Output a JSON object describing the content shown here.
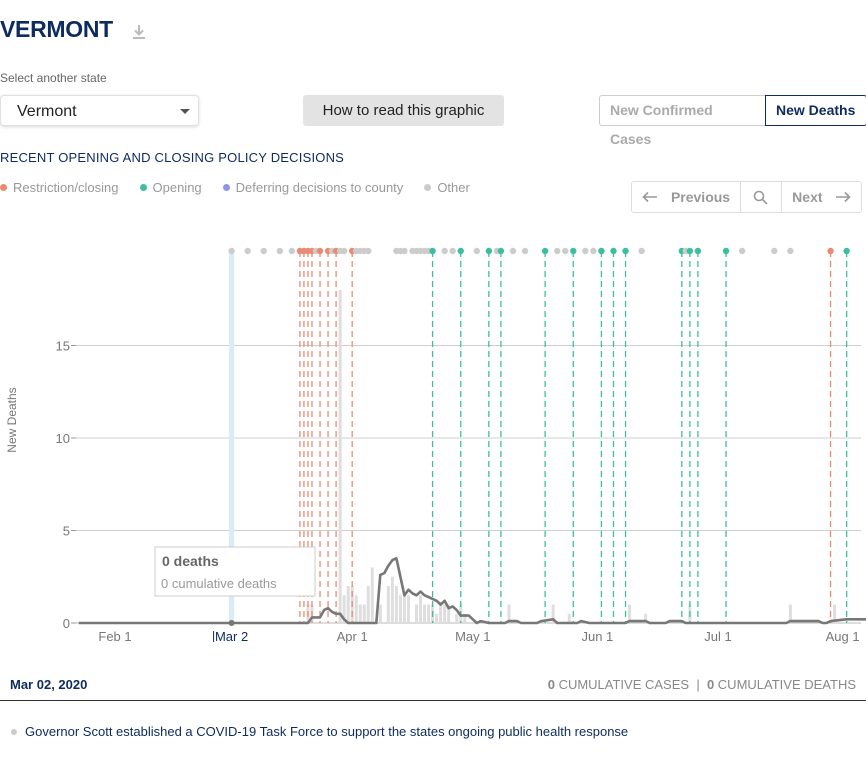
{
  "header": {
    "title": "VERMONT",
    "download_icon": "download-icon"
  },
  "state_select": {
    "label": "Select another state",
    "value": "Vermont"
  },
  "how_button": "How to read this graphic",
  "metric_toggle": {
    "options": [
      "New Confirmed Cases",
      "New Deaths"
    ],
    "selected": "New Deaths"
  },
  "policy": {
    "title": "RECENT OPENING AND CLOSING POLICY DECISIONS",
    "legend": [
      {
        "label": "Restriction/closing",
        "color": "#ea8a73"
      },
      {
        "label": "Opening",
        "color": "#3cbfa0"
      },
      {
        "label": "Deferring decisions to county",
        "color": "#8f92ee"
      },
      {
        "label": "Other",
        "color": "#cccccc"
      }
    ]
  },
  "pager": {
    "previous": "Previous",
    "next": "Next",
    "search_icon": "search-icon"
  },
  "tooltip": {
    "value": "0 deaths",
    "cumulative": "0 cumulative deaths"
  },
  "chart_data": {
    "type": "line",
    "ylabel": "New Deaths",
    "ylim": [
      0,
      19
    ],
    "yticks": [
      0,
      5,
      10,
      15
    ],
    "grid": true,
    "xtick_labels": [
      "Feb 1",
      "Mar 2",
      "Apr 1",
      "May 1",
      "Jun 1",
      "Jul 1",
      "Aug 1"
    ],
    "xtick_day": [
      31,
      60,
      90,
      120,
      151,
      181,
      212
    ],
    "selected_day": 60,
    "x_range_days": [
      22,
      220
    ],
    "bars_daily": [
      [
        79,
        1
      ],
      [
        80,
        1
      ],
      [
        87,
        18
      ],
      [
        88,
        1.5
      ],
      [
        89,
        2
      ],
      [
        90,
        2
      ],
      [
        91,
        1.5
      ],
      [
        92,
        1
      ],
      [
        93,
        1
      ],
      [
        94,
        2
      ],
      [
        95,
        3
      ],
      [
        97,
        1
      ],
      [
        99,
        2
      ],
      [
        100,
        2.5
      ],
      [
        101,
        2
      ],
      [
        102,
        1.5
      ],
      [
        103,
        1.5
      ],
      [
        104,
        1.5
      ],
      [
        106,
        1
      ],
      [
        107,
        1.5
      ],
      [
        108,
        1
      ],
      [
        109,
        1
      ],
      [
        110,
        1
      ],
      [
        111,
        0.5
      ],
      [
        112,
        1
      ],
      [
        113,
        1
      ],
      [
        114,
        1
      ],
      [
        116,
        0.5
      ],
      [
        117,
        1
      ],
      [
        118,
        0.5
      ],
      [
        129,
        1
      ],
      [
        140,
        1
      ],
      [
        144,
        0.5
      ],
      [
        159,
        1
      ],
      [
        163,
        0.5
      ],
      [
        174,
        1
      ],
      [
        199,
        1
      ],
      [
        210,
        1
      ],
      [
        219,
        1
      ]
    ],
    "series": [
      {
        "name": "7-day average",
        "points": [
          [
            22,
            0
          ],
          [
            79,
            0
          ],
          [
            80,
            0.3
          ],
          [
            82,
            0.3
          ],
          [
            83,
            0.7
          ],
          [
            84,
            0.8
          ],
          [
            85,
            0.6
          ],
          [
            86,
            0.5
          ],
          [
            87,
            0.5
          ],
          [
            88,
            0.2
          ],
          [
            89,
            0
          ],
          [
            96,
            0
          ],
          [
            97,
            2.6
          ],
          [
            98,
            2.7
          ],
          [
            99,
            3.1
          ],
          [
            100,
            3.4
          ],
          [
            101,
            3.5
          ],
          [
            102,
            2.5
          ],
          [
            103,
            1.5
          ],
          [
            104,
            1.8
          ],
          [
            105,
            1.6
          ],
          [
            106,
            1.5
          ],
          [
            107,
            1.7
          ],
          [
            108,
            1.5
          ],
          [
            109,
            1.4
          ],
          [
            110,
            1.3
          ],
          [
            111,
            1.2
          ],
          [
            112,
            1
          ],
          [
            113,
            1.2
          ],
          [
            114,
            0.8
          ],
          [
            115,
            0.9
          ],
          [
            116,
            0.7
          ],
          [
            117,
            0.4
          ],
          [
            118,
            0.4
          ],
          [
            119,
            0.4
          ],
          [
            120,
            0.2
          ],
          [
            121,
            0
          ],
          [
            122,
            0.1
          ],
          [
            124,
            0
          ],
          [
            128,
            0
          ],
          [
            129,
            0.1
          ],
          [
            131,
            0.1
          ],
          [
            132,
            0
          ],
          [
            136,
            0
          ],
          [
            137,
            0.1
          ],
          [
            140,
            0.2
          ],
          [
            141,
            0
          ],
          [
            146,
            0
          ],
          [
            147,
            0.1
          ],
          [
            149,
            0
          ],
          [
            158,
            0
          ],
          [
            159,
            0.1
          ],
          [
            163,
            0.1
          ],
          [
            164,
            0
          ],
          [
            168,
            0
          ],
          [
            169,
            0.1
          ],
          [
            172,
            0.1
          ],
          [
            173,
            0
          ],
          [
            198,
            0
          ],
          [
            199,
            0.1
          ],
          [
            206,
            0.1
          ],
          [
            207,
            0
          ],
          [
            208,
            0
          ],
          [
            209,
            0.1
          ],
          [
            213,
            0.2
          ],
          [
            219,
            0.2
          ]
        ]
      }
    ],
    "policy_events": [
      {
        "day": 60,
        "kind": "other"
      },
      {
        "day": 64,
        "kind": "other"
      },
      {
        "day": 68,
        "kind": "other"
      },
      {
        "day": 72,
        "kind": "other"
      },
      {
        "day": 75,
        "kind": "other"
      },
      {
        "day": 77,
        "kind": "closing"
      },
      {
        "day": 78,
        "kind": "closing"
      },
      {
        "day": 79,
        "kind": "closing"
      },
      {
        "day": 80,
        "kind": "closing"
      },
      {
        "day": 81,
        "kind": "other"
      },
      {
        "day": 82,
        "kind": "closing"
      },
      {
        "day": 84,
        "kind": "closing"
      },
      {
        "day": 85,
        "kind": "other"
      },
      {
        "day": 86,
        "kind": "closing"
      },
      {
        "day": 87,
        "kind": "other"
      },
      {
        "day": 88,
        "kind": "other"
      },
      {
        "day": 90,
        "kind": "closing"
      },
      {
        "day": 91,
        "kind": "other"
      },
      {
        "day": 92,
        "kind": "other"
      },
      {
        "day": 93,
        "kind": "other"
      },
      {
        "day": 94,
        "kind": "other"
      },
      {
        "day": 101,
        "kind": "other"
      },
      {
        "day": 102,
        "kind": "other"
      },
      {
        "day": 103,
        "kind": "other"
      },
      {
        "day": 105,
        "kind": "other"
      },
      {
        "day": 106,
        "kind": "other"
      },
      {
        "day": 107,
        "kind": "other"
      },
      {
        "day": 108,
        "kind": "other"
      },
      {
        "day": 109,
        "kind": "other"
      },
      {
        "day": 110,
        "kind": "opening"
      },
      {
        "day": 113,
        "kind": "other"
      },
      {
        "day": 115,
        "kind": "other"
      },
      {
        "day": 117,
        "kind": "opening"
      },
      {
        "day": 121,
        "kind": "other"
      },
      {
        "day": 124,
        "kind": "opening"
      },
      {
        "day": 126,
        "kind": "other"
      },
      {
        "day": 127,
        "kind": "opening"
      },
      {
        "day": 130,
        "kind": "other"
      },
      {
        "day": 133,
        "kind": "other"
      },
      {
        "day": 138,
        "kind": "opening"
      },
      {
        "day": 141,
        "kind": "other"
      },
      {
        "day": 143,
        "kind": "other"
      },
      {
        "day": 145,
        "kind": "opening"
      },
      {
        "day": 148,
        "kind": "other"
      },
      {
        "day": 150,
        "kind": "other"
      },
      {
        "day": 152,
        "kind": "other"
      },
      {
        "day": 152,
        "kind": "opening"
      },
      {
        "day": 155,
        "kind": "opening"
      },
      {
        "day": 158,
        "kind": "opening"
      },
      {
        "day": 162,
        "kind": "other"
      },
      {
        "day": 172,
        "kind": "opening"
      },
      {
        "day": 173,
        "kind": "other"
      },
      {
        "day": 174,
        "kind": "opening"
      },
      {
        "day": 176,
        "kind": "other"
      },
      {
        "day": 176,
        "kind": "opening"
      },
      {
        "day": 183,
        "kind": "opening"
      },
      {
        "day": 187,
        "kind": "other"
      },
      {
        "day": 195,
        "kind": "other"
      },
      {
        "day": 199,
        "kind": "other"
      },
      {
        "day": 209,
        "kind": "closing"
      },
      {
        "day": 213,
        "kind": "opening"
      }
    ]
  },
  "footer": {
    "date": "Mar 02, 2020",
    "cumulative_cases_value": "0",
    "cumulative_cases_label": "CUMULATIVE CASES",
    "separator": "|",
    "cumulative_deaths_value": "0",
    "cumulative_deaths_label": "CUMULATIVE DEATHS",
    "event": "Governor Scott established a COVID-19 Task Force to support the states ongoing public health response"
  }
}
